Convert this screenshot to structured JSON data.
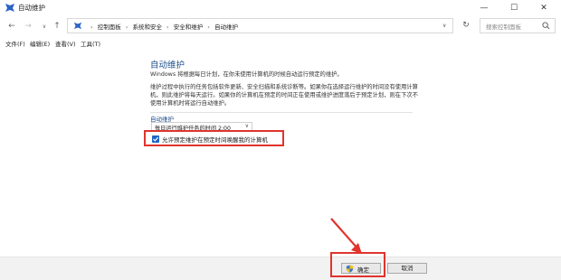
{
  "window": {
    "title": "自动维护",
    "min_glyph": "—",
    "max_glyph": "☐",
    "close_glyph": "✕"
  },
  "nav": {
    "back_glyph": "←",
    "forward_glyph": "→",
    "recent_glyph": "∨",
    "up_glyph": "↑",
    "refresh_glyph": "↻",
    "breadcrumbs": [
      "控制面板",
      "系统和安全",
      "安全和维护",
      "自动维护"
    ],
    "crumb_separator": "›",
    "dropdown_glyph": "∨",
    "search_placeholder": "搜索控制面板"
  },
  "menu": {
    "items": [
      "文件(F)",
      "编辑(E)",
      "查看(V)",
      "工具(T)"
    ]
  },
  "main": {
    "heading": "自动维护",
    "intro": "Windows 将根据每日计划，在你未使用计算机的时候自动运行预定的维护。",
    "details": "维护过程中执行的任务包括软件更新、安全扫描和系统诊断等。如果你在选择运行维护的时间没有使用计算机，则此维护将每天运行。如果你的计算机在预定的时间正在使用或维护进度落后于预定计划，则在下次不使用计算机时将运行自动维护。",
    "section_label": "自动维护",
    "time_select_value": "每日运行维护任务的时间 2:00",
    "time_select_chevron": "∨",
    "wake_checkbox_label": "允许预定维护在预定时间唤醒我的计算机",
    "wake_checkbox_checked": true
  },
  "footer": {
    "ok_label": "确定",
    "cancel_label": "取消"
  },
  "colors": {
    "accent": "#1e64c8",
    "heading": "#1e4e8c",
    "annotation_red": "#e0342d"
  },
  "icons": {
    "app": "control-panel-flag-icon",
    "ok": "uac-shield-icon",
    "search": "magnifier-icon"
  }
}
